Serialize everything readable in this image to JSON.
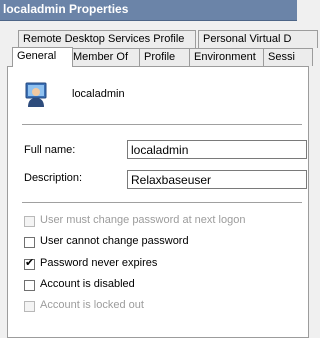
{
  "window": {
    "title": "localadmin Properties"
  },
  "tabs_back": [
    "Remote Desktop Services Profile",
    "Personal Virtual D"
  ],
  "tabs_front": [
    "General",
    "Member Of",
    "Profile",
    "Environment",
    "Sessi"
  ],
  "header": {
    "username": "localadmin"
  },
  "fields": {
    "full_name_label": "Full name:",
    "full_name_value": "localadmin",
    "description_label": "Description:",
    "description_value": "Relaxbaseuser"
  },
  "checkboxes": [
    {
      "label": "User must change password at next logon",
      "checked": false,
      "disabled": true
    },
    {
      "label": "User cannot change password",
      "checked": false,
      "disabled": false
    },
    {
      "label": "Password never expires",
      "checked": true,
      "disabled": false
    },
    {
      "label": "Account is disabled",
      "checked": false,
      "disabled": false
    },
    {
      "label": "Account is locked out",
      "checked": false,
      "disabled": true
    }
  ],
  "icons": {
    "user": "user-icon"
  }
}
